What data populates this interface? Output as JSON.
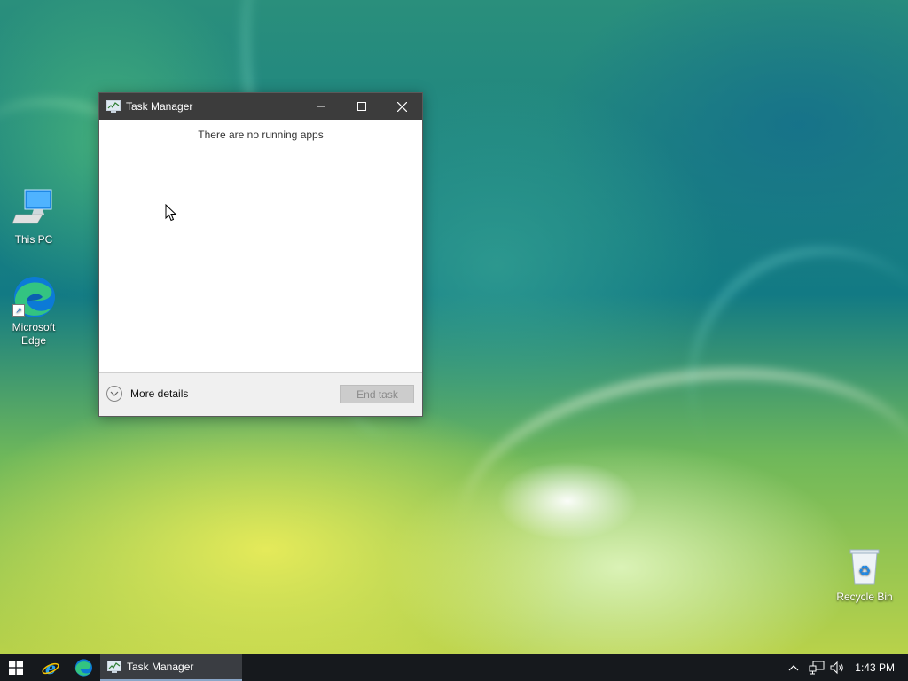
{
  "desktop": {
    "icons": [
      {
        "label": "This PC",
        "icon": "computer-icon"
      },
      {
        "label": "Microsoft Edge",
        "icon": "edge-icon"
      },
      {
        "label": "Recycle Bin",
        "icon": "recycle-bin-icon"
      }
    ]
  },
  "window": {
    "title": "Task Manager",
    "empty_message": "There are no running apps",
    "more_details_label": "More details",
    "end_task_label": "End task",
    "controls": [
      "minimize-icon",
      "maximize-icon",
      "close-icon"
    ]
  },
  "taskbar": {
    "pinned": [
      "windows-start-icon",
      "internet-explorer-icon",
      "edge-icon"
    ],
    "running_task_label": "Task Manager",
    "tray_icons": [
      "chevron-up-icon",
      "network-icon",
      "volume-icon"
    ],
    "clock": "1:43 PM"
  },
  "colors": {
    "titlebar": "#3c3c3c",
    "taskbar": "#16191d",
    "active_task": "#3a3d42"
  }
}
